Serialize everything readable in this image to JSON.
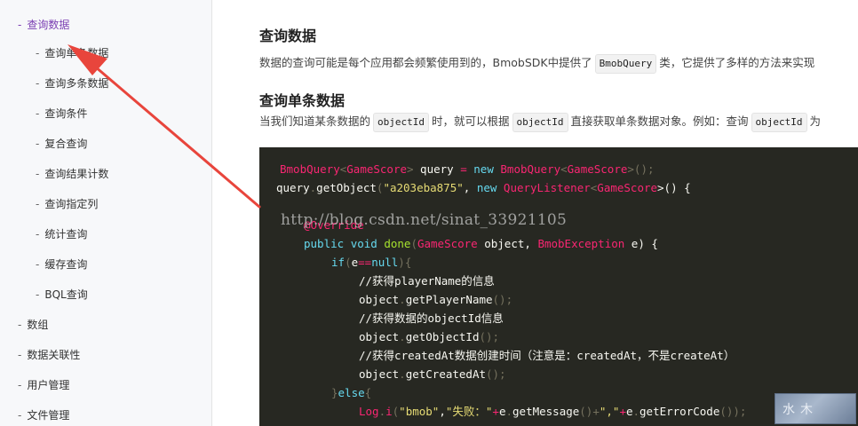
{
  "sidebar": {
    "items": [
      {
        "label": "查询数据",
        "active": true
      },
      {
        "label": "查询单条数据"
      },
      {
        "label": "查询多条数据"
      },
      {
        "label": "查询条件"
      },
      {
        "label": "复合查询"
      },
      {
        "label": "查询结果计数"
      },
      {
        "label": "查询指定列"
      },
      {
        "label": "统计查询"
      },
      {
        "label": "缓存查询"
      },
      {
        "label": "BQL查询"
      },
      {
        "label": "数组"
      },
      {
        "label": "数据关联性"
      },
      {
        "label": "用户管理"
      },
      {
        "label": "文件管理"
      }
    ],
    "dash": "-"
  },
  "content": {
    "heading1": "查询数据",
    "intro_before": "数据的查询可能是每个应用都会频繁使用到的，BmobSDK中提供了",
    "intro_code": "BmobQuery",
    "intro_after": "类，它提供了多样的方法来实现",
    "heading2": "查询单条数据",
    "p2_a": "当我们知道某条数据的",
    "p2_code1": "objectId",
    "p2_b": "时，就可以根据",
    "p2_code2": "objectId",
    "p2_c": "直接获取单条数据对象。例如：查询",
    "p2_code3": "objectId",
    "p2_d": "为"
  },
  "code": {
    "l1": {
      "a": "BmobQuery",
      "b": "<",
      "c": "GameScore",
      "d": ">",
      "e": " query ",
      "f": "=",
      "g": " new ",
      "h": "BmobQuery",
      "i": "<",
      "j": "GameScore",
      "k": ">();"
    },
    "l2": {
      "a": "query",
      "b": ".",
      "c": "getObject",
      "d": "(",
      "e": "\"a203eba875\"",
      "f": ", ",
      "g": "new ",
      "h": "QueryListener",
      "i": "<",
      "j": "GameScore",
      "k": ">() {"
    },
    "l3": "@Override",
    "l4": {
      "a": "public ",
      "b": "void ",
      "c": "done",
      "d": "(",
      "e": "GameScore",
      "f": " object, ",
      "g": "BmobException",
      "h": " e) {"
    },
    "l5": {
      "a": "if",
      "b": "(",
      "c": "e",
      "d": "==",
      "e": "null",
      "f": "){"
    },
    "l6": "//获得playerName的信息",
    "l7": {
      "a": "object",
      "b": ".",
      "c": "getPlayerName",
      "d": "();"
    },
    "l8": "//获得数据的objectId信息",
    "l9": {
      "a": "object",
      "b": ".",
      "c": "getObjectId",
      "d": "();"
    },
    "l10": "//获得createdAt数据创建时间（注意是：createdAt，不是createAt）",
    "l11": {
      "a": "object",
      "b": ".",
      "c": "getCreatedAt",
      "d": "();"
    },
    "l12": {
      "a": "}",
      "b": "else",
      "c": "{"
    },
    "l13": {
      "a": "Log",
      "b": ".",
      "c": "i",
      "d": "(",
      "e": "\"bmob\"",
      "f": ",",
      "g": "\"失败：\"",
      "h": "+",
      "i": "e",
      "j": ".",
      "k": "getMessage",
      "l": "()+",
      "m": "\",\"",
      "n": "+",
      "o": "e",
      "p": ".",
      "q": "getErrorCode",
      "r": "());"
    }
  },
  "watermark": "http://blog.csdn.net/sinat_33921105",
  "badge": "水木",
  "colors": {
    "accent": "#7b3fb3",
    "arrow": "#e8453c",
    "code_bg": "#272822"
  }
}
